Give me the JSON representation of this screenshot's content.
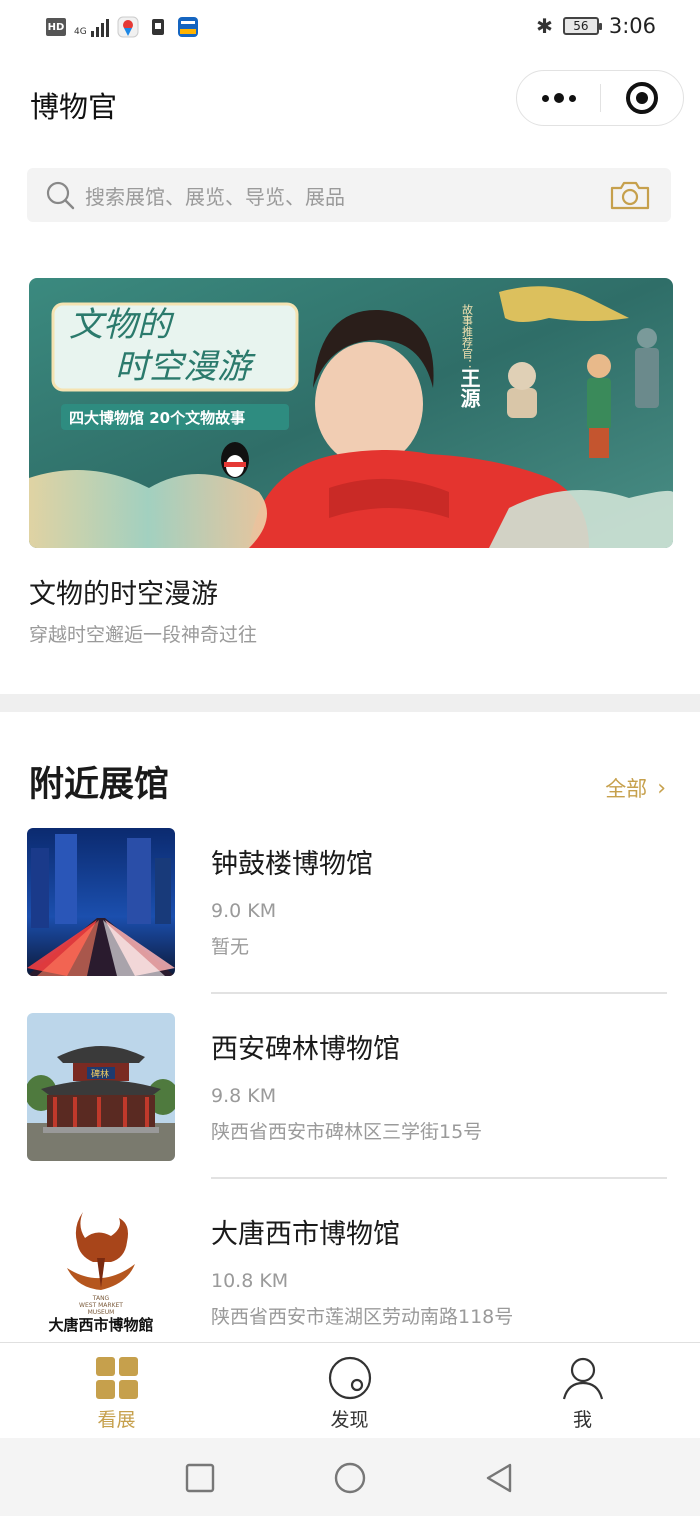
{
  "status_bar": {
    "hd": "HD",
    "network": "4G",
    "battery": "56",
    "time": "3:06"
  },
  "header": {
    "title": "博物官"
  },
  "search": {
    "placeholder": "搜索展馆、展览、导览、展品"
  },
  "featured": {
    "banner_title_line1": "文物的",
    "banner_title_line2": "时空漫游",
    "banner_tagline": "四大博物馆   20个文物故事",
    "banner_side_label": "故事推荐官：",
    "banner_side_name": "王源",
    "title": "文物的时空漫游",
    "subtitle": "穿越时空邂逅一段神奇过往"
  },
  "nearby": {
    "section_title": "附近展馆",
    "see_all": "全部",
    "museums": [
      {
        "name": "钟鼓楼博物馆",
        "distance": "9.0 KM",
        "address": "暂无"
      },
      {
        "name": "西安碑林博物馆",
        "distance": "9.8 KM",
        "address": "陕西省西安市碑林区三学街15号"
      },
      {
        "name": "大唐西市博物馆",
        "distance": "10.8 KM",
        "address": "陕西省西安市莲湖区劳动南路118号"
      }
    ],
    "logo_text_en1": "TANG",
    "logo_text_en2": "WEST MARKET",
    "logo_text_en3": "MUSEUM",
    "logo_text_cn": "大唐西市博物館",
    "plaque_text": "碑林"
  },
  "tabbar": {
    "tabs": [
      {
        "label": "看展",
        "icon": "grid-icon",
        "active": true
      },
      {
        "label": "发现",
        "icon": "compass-icon",
        "active": false
      },
      {
        "label": "我",
        "icon": "user-icon",
        "active": false
      }
    ]
  },
  "colors": {
    "accent": "#c6a04c",
    "text_primary": "#1a1a1a",
    "text_secondary": "#9a9a9a"
  }
}
